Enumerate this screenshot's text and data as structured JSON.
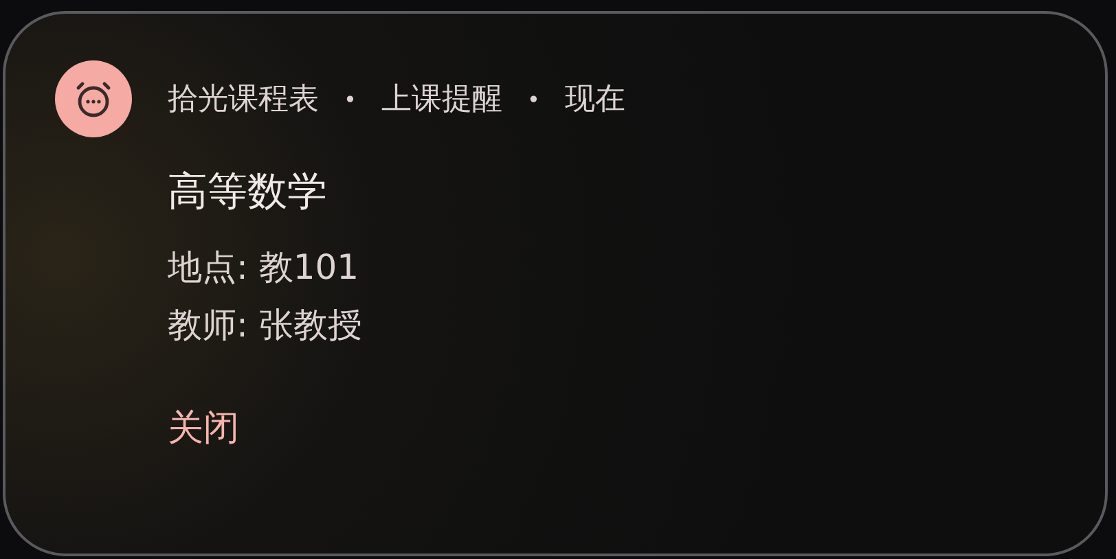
{
  "notification": {
    "app_name": "拾光课程表",
    "category": "上课提醒",
    "time": "现在",
    "separator": "•",
    "title": "高等数学",
    "lines": [
      "地点: 教101",
      "教师: 张教授"
    ],
    "actions": [
      "关闭"
    ]
  }
}
